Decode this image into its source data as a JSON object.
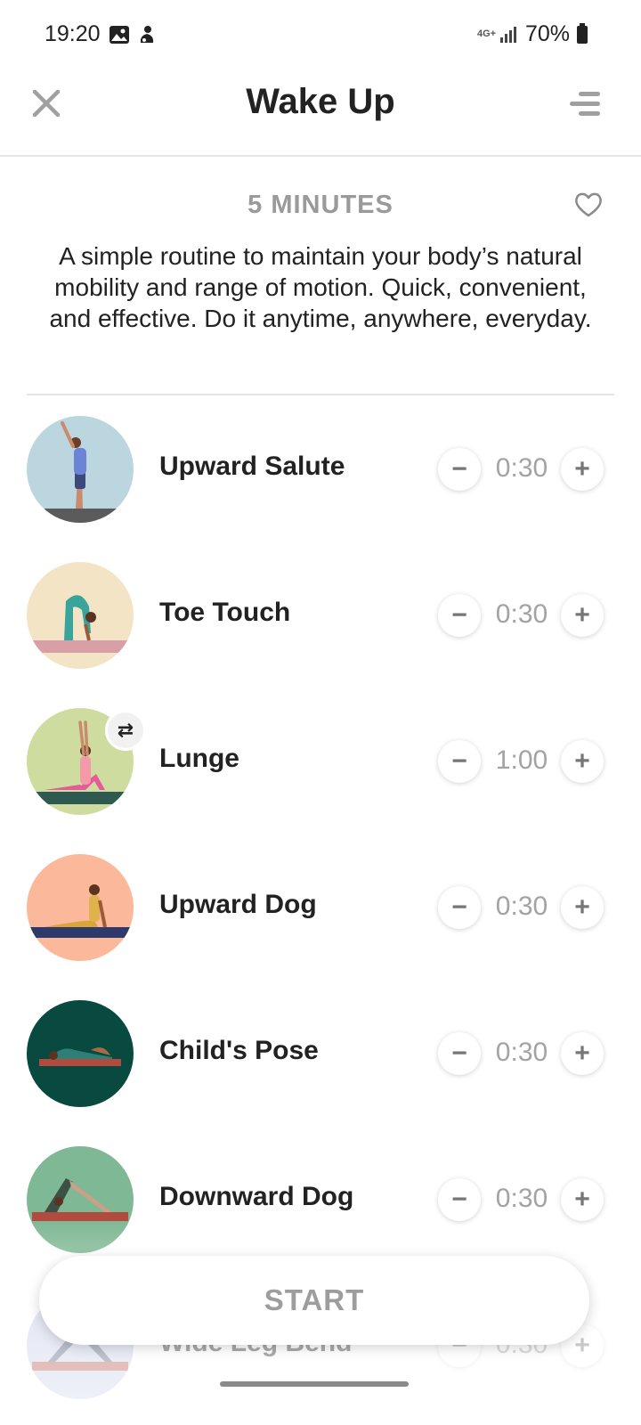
{
  "status_bar": {
    "time": "19:20",
    "network": "4G+",
    "battery": "70%",
    "icons": [
      "gallery-icon",
      "notification-icon",
      "signal-icon",
      "battery-icon"
    ]
  },
  "header": {
    "title": "Wake Up",
    "close_icon": "close-icon",
    "menu_icon": "menu-icon"
  },
  "routine": {
    "duration": "5 MINUTES",
    "favorite_icon": "heart-icon",
    "description": "A simple routine to maintain your body’s natural mobility and range of motion. Quick, convenient, and effective. Do it anytime, anywhere, everyday."
  },
  "exercises": [
    {
      "name": "Upward Salute",
      "duration": "0:30",
      "bg": "#bcd6df"
    },
    {
      "name": "Toe Touch",
      "duration": "0:30",
      "bg": "#f3e4c6"
    },
    {
      "name": "Lunge",
      "duration": "1:00",
      "bg": "#cedd9f",
      "swap": "⇄"
    },
    {
      "name": "Upward Dog",
      "duration": "0:30",
      "bg": "#fbb89a"
    },
    {
      "name": "Child's Pose",
      "duration": "0:30",
      "bg": "#084a3f"
    },
    {
      "name": "Downward Dog",
      "duration": "0:30",
      "bg": "#7fb894"
    },
    {
      "name": "Wide Leg Bend",
      "duration": "0:30",
      "bg": "#c6cde8"
    }
  ],
  "controls": {
    "minus": "−",
    "plus": "+"
  },
  "start_button": {
    "label": "START"
  },
  "colors": {
    "accent_text": "#9a9a9a",
    "divider": "#e3e3e3"
  }
}
